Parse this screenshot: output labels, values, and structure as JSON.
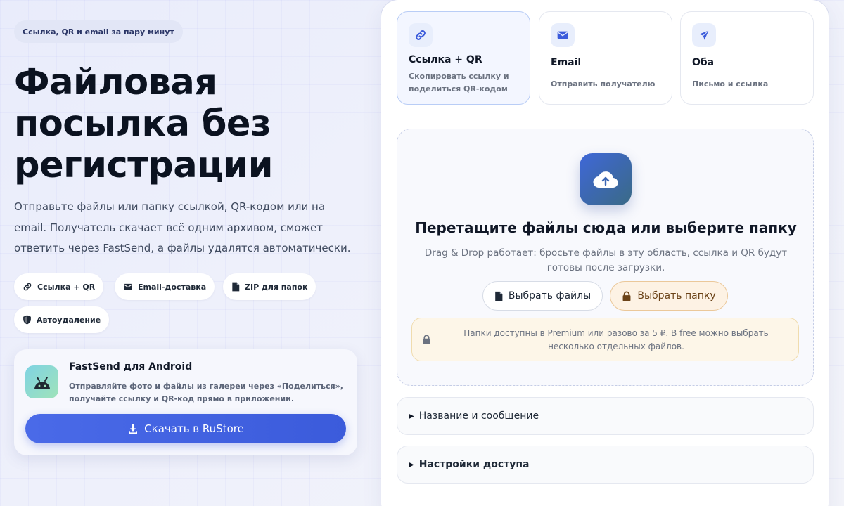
{
  "hero": {
    "tag": "Ссылка, QR и email за пару минут",
    "headline": "Файловая посылка без регистрации",
    "subtitle": "Отправьте файлы или папку ссылкой, QR-кодом или на email. Получатель скачает всё одним архивом, сможет ответить через FastSend, а файлы удалятся автоматически.",
    "chips": [
      {
        "label": "Ссылка + QR",
        "icon": "link-icon"
      },
      {
        "label": "Email-доставка",
        "icon": "envelope-icon"
      },
      {
        "label": "ZIP для папок",
        "icon": "file-icon"
      },
      {
        "label": "Автоудаление",
        "icon": "shield-icon"
      }
    ]
  },
  "android": {
    "title": "FastSend для Android",
    "description": "Отправляйте фото и файлы из галереи через «Поделиться», получайте ссылку и QR-код прямо в приложении.",
    "button_label": "Скачать в RuStore"
  },
  "modes": [
    {
      "title": "Ссылка + QR",
      "description": "Скопировать ссылку и поделиться QR-кодом",
      "icon": "link-icon",
      "active": true
    },
    {
      "title": "Email",
      "description": "Отправить получателю",
      "icon": "envelope-icon",
      "active": false
    },
    {
      "title": "Оба",
      "description": "Письмо и ссылка",
      "icon": "paper-plane-icon",
      "active": false
    }
  ],
  "dropzone": {
    "title": "Перетащите файлы сюда или выберите папку",
    "description": "Drag & Drop работает: бросьте файлы в эту область, ссылка и QR будут готовы после загрузки.",
    "choose_files_label": "Выбрать файлы",
    "choose_folder_label": "Выбрать папку",
    "notice": "Папки доступны в Premium или разово за 5 ₽. В free можно выбрать несколько отдельных файлов."
  },
  "sections": [
    {
      "label": "Название и сообщение"
    },
    {
      "label": "Настройки доступа"
    }
  ],
  "colors": {
    "accent": "#3b5bdb",
    "folder_accent": "#6b4318",
    "notice_bg": "#fdf6e8"
  }
}
